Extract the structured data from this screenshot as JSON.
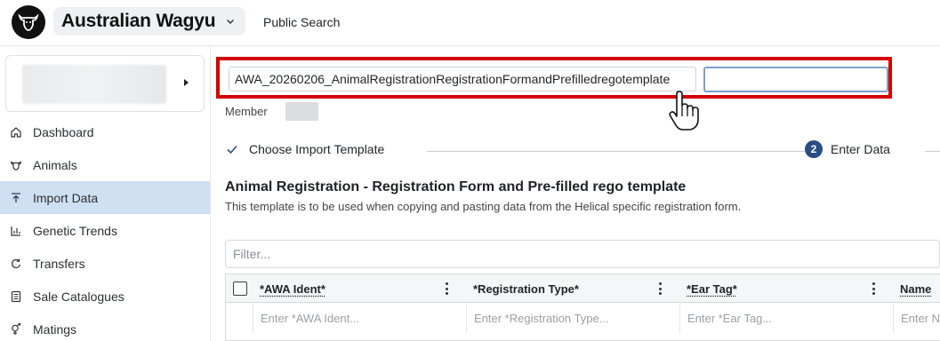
{
  "header": {
    "org_name": "Australian Wagyu",
    "public_search": "Public Search"
  },
  "sidebar": {
    "items": [
      {
        "label": "Dashboard",
        "icon": "home-icon",
        "active": false
      },
      {
        "label": "Animals",
        "icon": "cow-icon",
        "active": false
      },
      {
        "label": "Import Data",
        "icon": "upload-icon",
        "active": true
      },
      {
        "label": "Genetic Trends",
        "icon": "bar-chart-icon",
        "active": false
      },
      {
        "label": "Transfers",
        "icon": "transfer-icon",
        "active": false
      },
      {
        "label": "Sale Catalogues",
        "icon": "catalogue-icon",
        "active": false
      },
      {
        "label": "Matings",
        "icon": "gender-icon",
        "active": false
      }
    ]
  },
  "main": {
    "template_name": "AWA_20260206_AnimalRegistrationRegistrationFormandPrefilledregotemplate",
    "template_input_value": "",
    "member_label": "Member",
    "steps": [
      {
        "label": "Choose Import Template",
        "state": "done"
      },
      {
        "number": "2",
        "label": "Enter Data",
        "state": "current"
      }
    ],
    "title": "Animal Registration - Registration Form and Pre-filled rego template",
    "description": "This template is to be used when copying and pasting data from the Helical specific registration form.",
    "filter_placeholder": "Filter...",
    "grid": {
      "columns": [
        "*AWA Ident*",
        "*Registration Type*",
        "*Ear Tag*",
        "Name"
      ],
      "placeholders": [
        "Enter *AWA Ident...",
        "Enter *Registration Type...",
        "Enter *Ear Tag...",
        "Enter N"
      ]
    }
  },
  "colors": {
    "highlight": "#d40000",
    "active_nav": "#cfe0f3",
    "step_badge": "#2a4d84"
  }
}
